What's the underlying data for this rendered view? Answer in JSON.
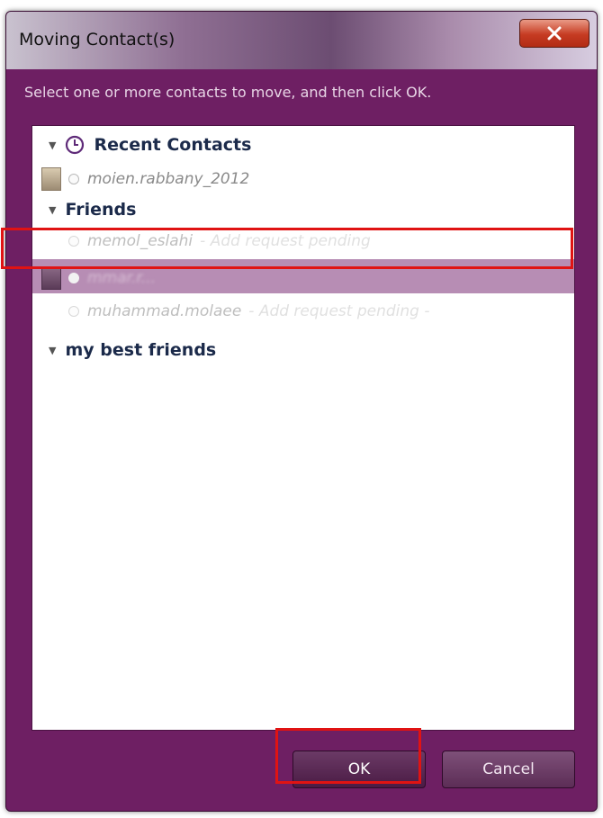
{
  "window": {
    "title": "Moving Contact(s)",
    "instruction": "Select one or more contacts to move, and then click OK."
  },
  "groups": [
    {
      "label": "Recent Contacts",
      "icon": "clock-icon"
    },
    {
      "label": "Friends"
    },
    {
      "label": "my best friends"
    }
  ],
  "contacts": {
    "recent_1": {
      "name": "moien.rabbany_2012"
    },
    "friend_1": {
      "name": "memol_eslahi",
      "status": "- Add request pending"
    },
    "friend_2": {
      "name": "mmar.r..."
    },
    "friend_3": {
      "name": "muhammad.molaee",
      "status": "- Add request pending -"
    }
  },
  "buttons": {
    "ok": "OK",
    "cancel": "Cancel"
  },
  "colors": {
    "window_bg": "#6e1f63",
    "selection": "#b78db4",
    "highlight": "#e01313"
  }
}
